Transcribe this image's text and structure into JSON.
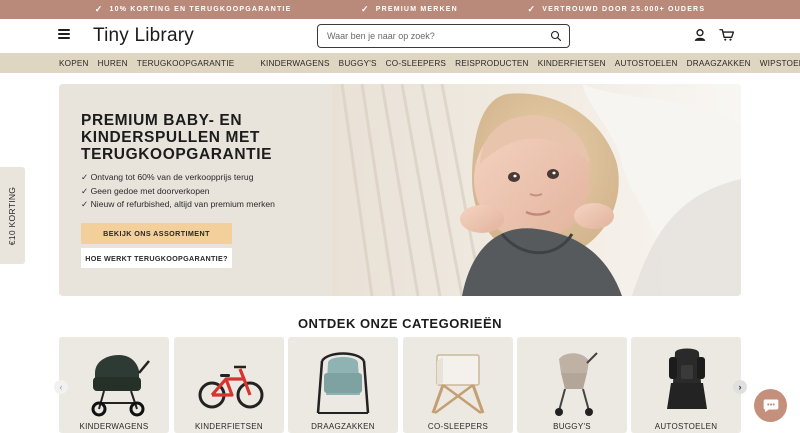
{
  "promo": {
    "items": [
      "10% KORTING EN TERUGKOOPGARANTIE",
      "PREMIUM MERKEN",
      "VERTROUWD DOOR 25.000+ OUDERS"
    ]
  },
  "header": {
    "logo": "Tiny Library",
    "search_placeholder": "Waar ben je naar op zoek?"
  },
  "nav": {
    "left": [
      "KOPEN",
      "HUREN",
      "TERUGKOOPGARANTIE"
    ],
    "right": [
      "KINDERWAGENS",
      "BUGGY'S",
      "CO-SLEEPERS",
      "REISPRODUCTEN",
      "KINDERFIETSEN",
      "AUTOSTOELEN",
      "DRAAGZAKKEN",
      "WIPSTOELEN"
    ]
  },
  "hero": {
    "title": "PREMIUM BABY- EN KINDERSPULLEN MET TERUGKOOPGARANTIE",
    "bullets": [
      "✓ Ontvang tot 60% van de verkoopprijs terug",
      "✓ Geen gedoe met doorverkopen",
      "✓ Nieuw of refurbished, altijd van premium merken"
    ],
    "primary_cta": "BEKIJK ONS ASSORTIMENT",
    "secondary_cta": "HOE WERKT TERUGKOOPGARANTIE?"
  },
  "side_tab": "€10 KORTING",
  "categories": {
    "title": "ONTDEK ONZE CATEGORIEËN",
    "items": [
      "KINDERWAGENS",
      "KINDERFIETSEN",
      "DRAAGZAKKEN",
      "CO-SLEEPERS",
      "BUGGY'S",
      "AUTOSTOELEN"
    ]
  },
  "icons": {
    "menu": "hamburger-icon",
    "search": "search-icon",
    "account": "user-icon",
    "cart": "cart-icon",
    "prev": "chevron-left-icon",
    "next": "chevron-right-icon",
    "chat": "chat-icon"
  },
  "colors": {
    "promo_bar": "#b98a7a",
    "nav_bar": "#ded6c0",
    "primary_button": "#f2cf9b",
    "chat_button": "#c4907c"
  }
}
